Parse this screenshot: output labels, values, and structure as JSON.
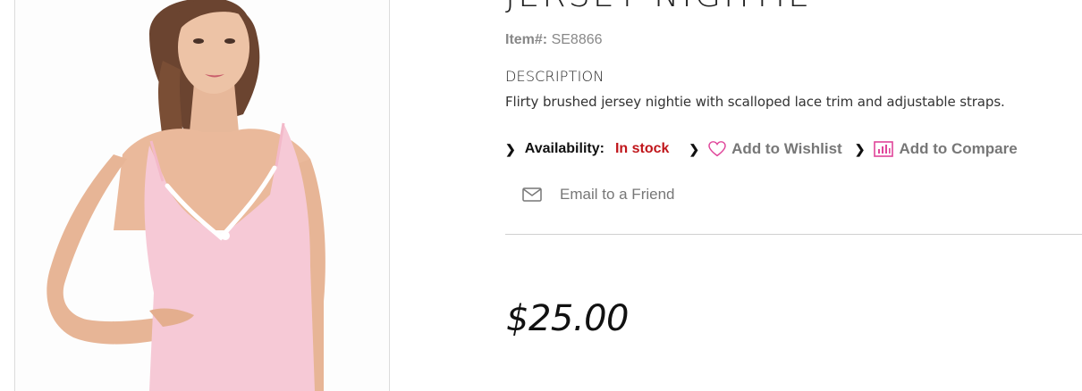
{
  "product": {
    "title": "JERSEY NIGHTIE",
    "item_label": "Item#:",
    "item_number": "SE8866",
    "description_heading": "DESCRIPTION",
    "description": "Flirty brushed jersey nightie with scalloped lace trim and adjustable straps.",
    "price": "$25.00"
  },
  "availability": {
    "label": "Availability:",
    "value": "In stock"
  },
  "actions": {
    "wishlist": "Add to Wishlist",
    "compare": "Add to Compare",
    "email": "Email to a Friend"
  },
  "icons": {
    "wishlist": "heart-outline-icon",
    "compare": "bar-chart-icon",
    "email": "envelope-icon",
    "separator": "chevron-right-icon"
  },
  "colors": {
    "accent_pink": "#e0459a",
    "stock_red": "#c0161b",
    "link_gray": "#777777",
    "garment_pink": "#f6c9d6"
  }
}
